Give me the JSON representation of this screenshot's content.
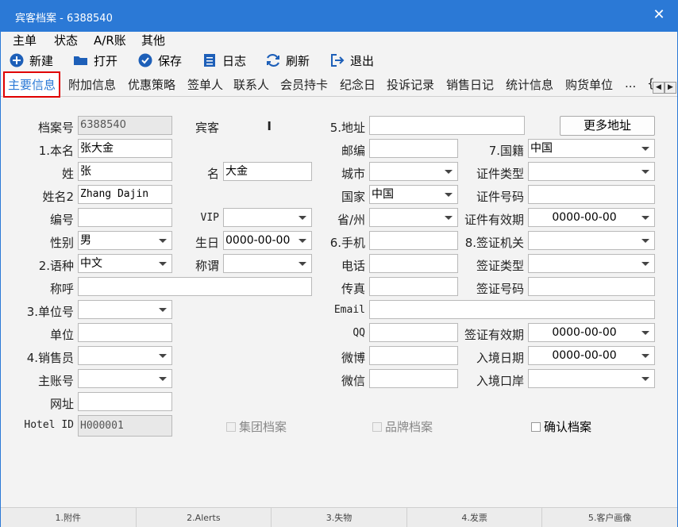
{
  "window": {
    "title": "宾客档案 - 6388540",
    "close": "✕"
  },
  "menu": [
    "主单",
    "状态",
    "A/R账",
    "其他"
  ],
  "toolbar": {
    "new": "新建",
    "open": "打开",
    "save": "保存",
    "log": "日志",
    "refresh": "刷新",
    "exit": "退出"
  },
  "tabs": [
    "主要信息",
    "附加信息",
    "优惠策略",
    "签单人",
    "联系人",
    "会员持卡",
    "纪念日",
    "投诉记录",
    "销售日记",
    "统计信息",
    "购货单位",
    "...",
    "{"
  ],
  "tab_scroll": {
    "left": "◀",
    "right": "▶"
  },
  "form": {
    "left": {
      "file_no_label": "档案号",
      "file_no": "6388540",
      "name_label": "1.本名",
      "name": "张大金",
      "surname_label": "姓",
      "surname": "张",
      "name2_label": "姓名2",
      "name2": "Zhang Dajin",
      "code_label": "编号",
      "code": "",
      "gender_label": "性别",
      "gender": "男",
      "language_label": "2.语种",
      "language": "中文",
      "salutation_label": "称呼",
      "salutation": "",
      "unit_no_label": "3.单位号",
      "unit_no": "",
      "unit_label": "单位",
      "unit": "",
      "sales_label": "4.销售员",
      "sales": "",
      "master_label": "主账号",
      "master": "",
      "website_label": "网址",
      "website": "",
      "hotel_id_label": "Hotel ID",
      "hotel_id": "H000001"
    },
    "mid": {
      "guest_label": "宾客",
      "guest": "I",
      "given_label": "名",
      "given": "大金",
      "vip_label": "VIP",
      "vip": "",
      "birthday_label": "生日",
      "birthday": "0000-00-00",
      "title_label": "称谓",
      "title": ""
    },
    "right": {
      "address_label": "5.地址",
      "address": "",
      "more_address": "更多地址",
      "postcode_label": "邮编",
      "postcode": "",
      "nationality_label": "7.国籍",
      "nationality": "中国",
      "city_label": "城市",
      "city": "",
      "id_type_label": "证件类型",
      "id_type": "",
      "country_label": "国家",
      "country": "中国",
      "id_no_label": "证件号码",
      "id_no": "",
      "province_label": "省/州",
      "province": "",
      "id_valid_label": "证件有效期",
      "id_valid": "0000-00-00",
      "mobile_label": "6.手机",
      "mobile": "",
      "visa_office_label": "8.签证机关",
      "visa_office": "",
      "phone_label": "电话",
      "phone": "",
      "visa_type_label": "签证类型",
      "visa_type": "",
      "fax_label": "传真",
      "fax": "",
      "visa_no_label": "签证号码",
      "visa_no": "",
      "email_label": "Email",
      "email": "",
      "qq_label": "QQ",
      "qq": "",
      "visa_valid_label": "签证有效期",
      "visa_valid": "0000-00-00",
      "weibo_label": "微博",
      "weibo": "",
      "entry_date_label": "入境日期",
      "entry_date": "0000-00-00",
      "wechat_label": "微信",
      "wechat": "",
      "entry_port_label": "入境口岸",
      "entry_port": ""
    },
    "checks": {
      "group": "集团档案",
      "brand": "品牌档案",
      "confirm": "确认档案"
    }
  },
  "bottom": [
    "1.附件",
    "2.Alerts",
    "3.失物",
    "4.发票",
    "5.客户画像"
  ],
  "colors": {
    "accent": "#2b79d6",
    "highlight": "#e00000"
  }
}
